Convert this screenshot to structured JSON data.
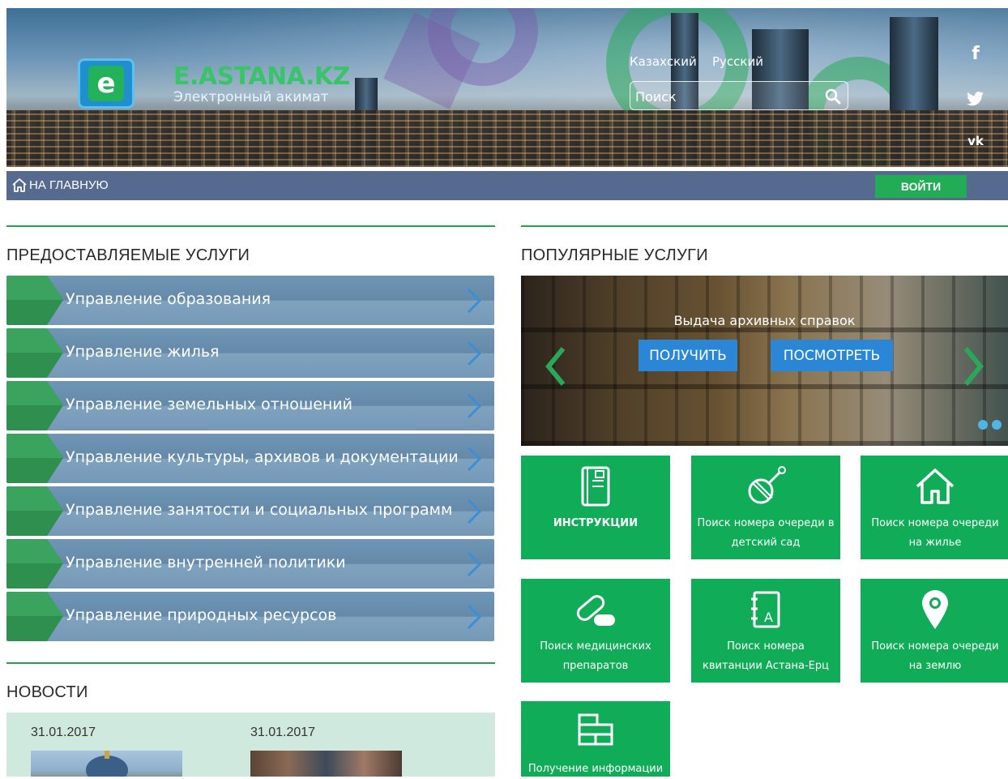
{
  "header": {
    "logo_letter": "e",
    "logo_title": "E.ASTANA.KZ",
    "logo_subtitle": "Электронный акимат",
    "languages": [
      "Казахский",
      "Русский"
    ],
    "search_placeholder": "Поиск",
    "social": [
      "facebook-icon",
      "twitter-icon",
      "vk-icon"
    ]
  },
  "nav": {
    "home_label": "НА ГЛАВНУЮ",
    "login_label": "ВОЙТИ"
  },
  "services": {
    "title": "ПРЕДОСТАВЛЯЕМЫЕ УСЛУГИ",
    "items": [
      "Управление образования",
      "Управление жилья",
      "Управление земельных отношений",
      "Управление культуры, архивов и документации",
      "Управление занятости и социальных программ",
      "Управление внутренней политики",
      "Управление природных ресурсов"
    ]
  },
  "popular": {
    "title": "ПОПУЛЯРНЫЕ УСЛУГИ",
    "carousel": {
      "caption": "Выдача архивных справок",
      "btn_get": "ПОЛУЧИТЬ",
      "btn_view": "ПОСМОТРЕТЬ"
    },
    "tiles": [
      {
        "label": "ИНСТРУКЦИИ",
        "icon": "book-icon"
      },
      {
        "label": "Поиск номера очереди в детский сад",
        "icon": "toy-rattle-icon"
      },
      {
        "label": "Поиск номера очереди на жилье",
        "icon": "house-icon"
      },
      {
        "label": "Поиск медицинских препаратов",
        "icon": "pills-icon"
      },
      {
        "label": "Поиск номера квитанции Астана-Ерц",
        "icon": "notebook-icon"
      },
      {
        "label": "Поиск номера очереди на землю",
        "icon": "map-pin-icon"
      },
      {
        "label": "Получение информации",
        "icon": "bricks-icon"
      }
    ]
  },
  "news": {
    "title": "НОВОСТИ",
    "items": [
      {
        "date": "31.01.2017"
      },
      {
        "date": "31.01.2017"
      }
    ]
  },
  "colors": {
    "accent_green": "#11ac58",
    "nav_bar": "#56698f",
    "service_blue": "#6f96b5",
    "news_bg": "#d0e9de"
  }
}
